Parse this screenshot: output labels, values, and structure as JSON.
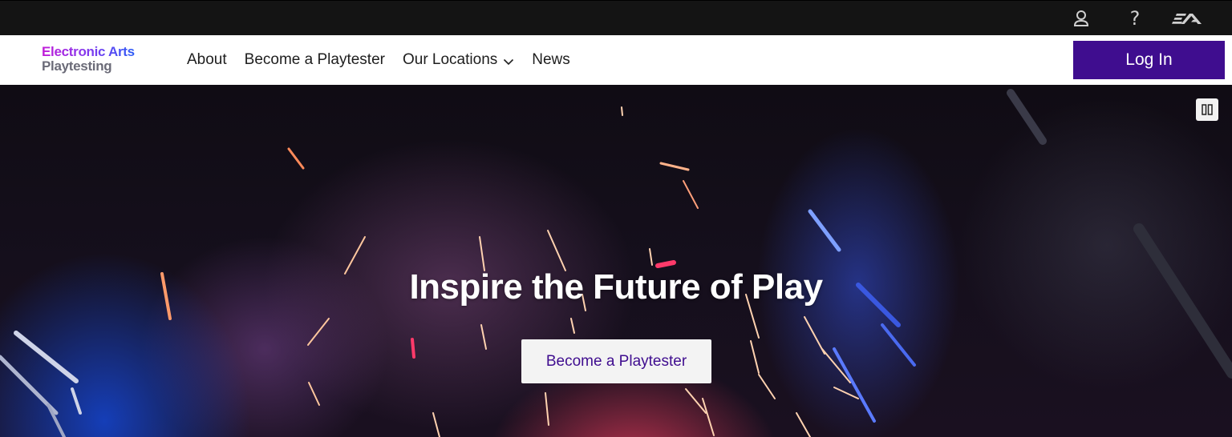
{
  "utility_bar": {
    "icons": [
      "account-icon",
      "help-icon",
      "ea-logo-icon"
    ],
    "help_glyph": "?"
  },
  "brand": {
    "line1": "Electronic Arts",
    "line2": "Playtesting"
  },
  "nav": {
    "items": [
      {
        "label": "About"
      },
      {
        "label": "Become a Playtester"
      },
      {
        "label": "Our Locations",
        "has_dropdown": true
      },
      {
        "label": "News"
      }
    ],
    "login_label": "Log In"
  },
  "hero": {
    "title": "Inspire the Future of Play",
    "cta_label": "Become a Playtester",
    "video_control": "pause-icon"
  },
  "colors": {
    "topbar_bg": "#141414",
    "primary": "#3f0d8f",
    "nav_bg": "#ffffff",
    "hero_text": "#ffffff"
  }
}
